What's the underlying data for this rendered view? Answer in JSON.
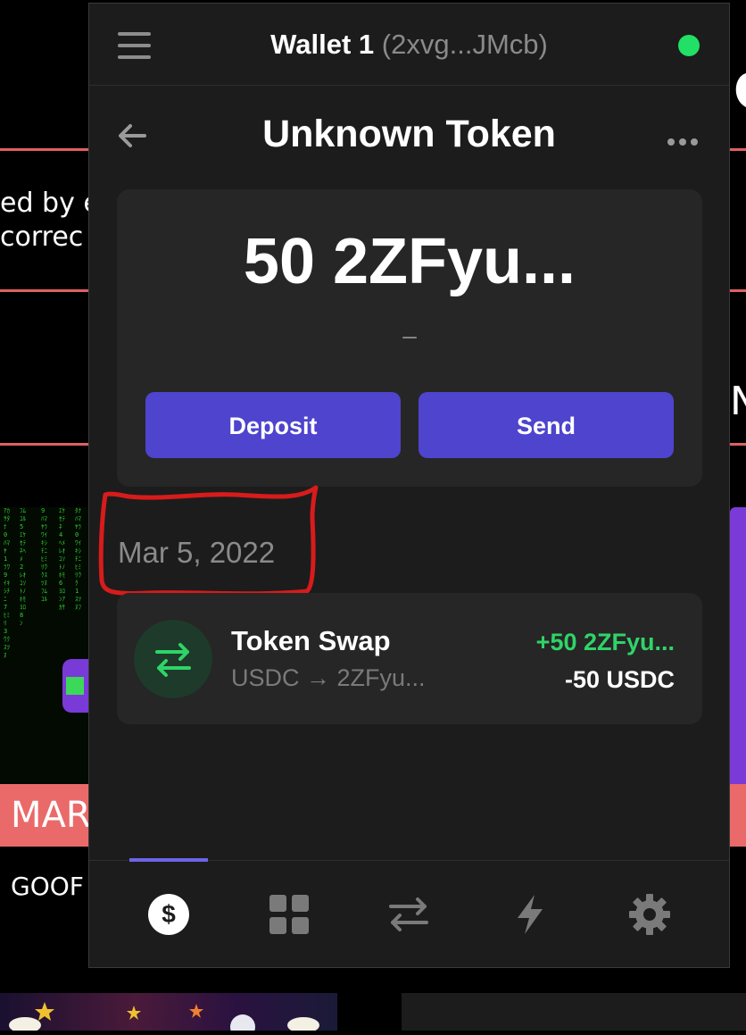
{
  "background": {
    "text_line1": "ed by e",
    "text_line2": " correc",
    "right_letter": "N",
    "banner_text": "MAR",
    "below_banner": "GOOF"
  },
  "wallet": {
    "name": "Wallet 1",
    "address_short": "(2xvg...JMcb)",
    "status_color": "#21e065"
  },
  "page": {
    "title": "Unknown Token"
  },
  "balance": {
    "amount": "50 2ZFyu...",
    "fiat": "–"
  },
  "actions": {
    "deposit_label": "Deposit",
    "send_label": "Send"
  },
  "activity": {
    "date": "Mar 5, 2022",
    "transactions": [
      {
        "title": "Token Swap",
        "subtitle": "USDC → 2ZFyu...",
        "amount_in": "+50 2ZFyu...",
        "amount_out": "-50 USDC"
      }
    ]
  },
  "tabs": [
    {
      "icon": "dollar-icon",
      "active": true
    },
    {
      "icon": "grid-icon",
      "active": false
    },
    {
      "icon": "swap-icon",
      "active": false
    },
    {
      "icon": "lightning-icon",
      "active": false
    },
    {
      "icon": "gear-icon",
      "active": false
    }
  ],
  "colors": {
    "accent": "#4e44ce",
    "positive": "#2fd468",
    "annotation": "#d81b1b"
  }
}
